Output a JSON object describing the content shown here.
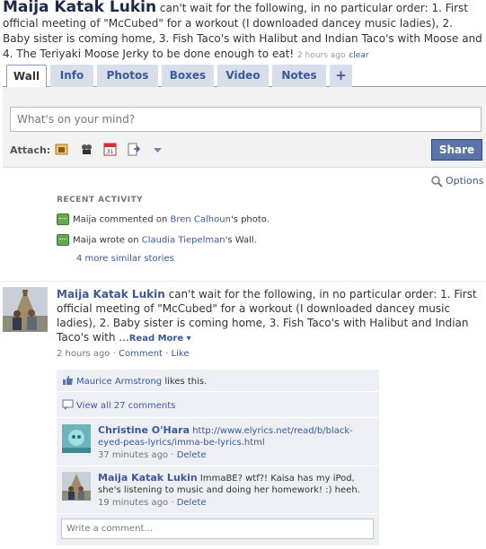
{
  "header": {
    "name": "Maija Katak Lukin",
    "status": "can't wait for the following, in no particular order: 1. First official meeting of \"McCubed\" for a workout (I downloaded dancey music ladies), 2. Baby sister is coming home, 3. Fish Taco's with Halibut and Indian Taco's with Moose and 4. The Teriyaki Moose Jerky to be done enough to eat!",
    "time": "2 hours ago",
    "clear": "clear"
  },
  "tabs": [
    {
      "label": "Wall"
    },
    {
      "label": "Info"
    },
    {
      "label": "Photos"
    },
    {
      "label": "Boxes"
    },
    {
      "label": "Video"
    },
    {
      "label": "Notes"
    },
    {
      "label": "+"
    }
  ],
  "publisher": {
    "placeholder": "What's on your mind?",
    "attach_label": "Attach:",
    "share_label": "Share",
    "attach_icons": [
      "photo-icon",
      "video-icon",
      "event-icon",
      "link-icon",
      "dropdown-arrow-icon"
    ]
  },
  "options_label": "Options",
  "recent_activity": {
    "title": "RECENT ACTIVITY",
    "items": [
      {
        "actor": "Maija",
        "verb": "commented on",
        "target": "Bren Calhoun",
        "suffix": "'s photo."
      },
      {
        "actor": "Maija",
        "verb": "wrote on",
        "target": "Claudia Tiepelman",
        "suffix": "'s Wall."
      }
    ],
    "more": "4 more similar stories"
  },
  "story": {
    "name": "Maija Katak Lukin",
    "text": "can't wait for the following, in no particular order: 1. First official meeting of \"McCubed\" for a workout (I downloaded dancey music ladies), 2. Baby sister is coming home, 3. Fish Taco's with Halibut and Indian Taco's with ...",
    "read_more": "Read More",
    "time": "2 hours ago",
    "comment_link": "Comment",
    "like_link": "Like",
    "likes": {
      "name": "Maurice Armstrong",
      "suffix": "likes this."
    },
    "view_all": "View all 27 comments",
    "comments": [
      {
        "author": "Christine O'Hara",
        "text": "http://www.elyrics.net/read/b/black-eyed-peas-lyrics/imma-be-lyrics.html",
        "time": "37 minutes ago",
        "delete": "Delete"
      },
      {
        "author": "Maija Katak Lukin",
        "text": "ImmaBE? wtf?! Kaisa has my iPod, she's listening to music and doing her homework! :) heeh.",
        "time": "19 minutes ago",
        "delete": "Delete"
      }
    ],
    "write_placeholder": "Write a comment..."
  },
  "colors": {
    "link": "#3b5998",
    "tab_bg": "#d8dfea",
    "share_bg": "#5b74a8",
    "ufi_bg": "#edeff4"
  }
}
